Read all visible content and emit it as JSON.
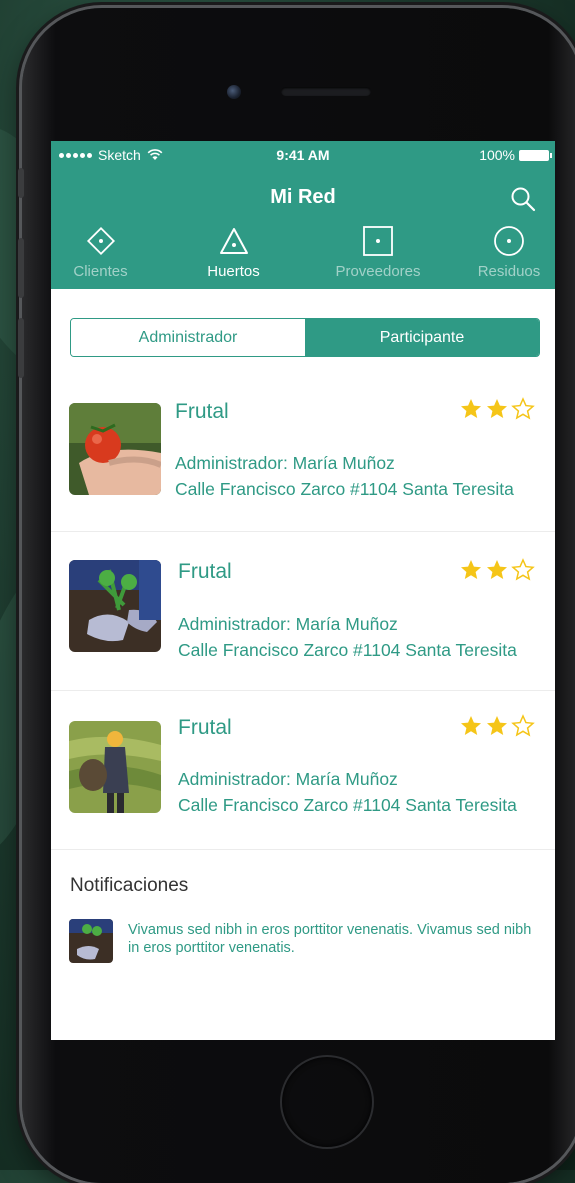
{
  "status_bar": {
    "carrier": "Sketch",
    "time": "9:41 AM",
    "battery": "100%"
  },
  "nav": {
    "title": "Mi Red",
    "icons": [
      "search-icon"
    ]
  },
  "tabs": [
    {
      "label": "Clientes",
      "icon": "diamond-dot-icon",
      "active": false
    },
    {
      "label": "Huertos",
      "icon": "triangle-dot-icon",
      "active": true
    },
    {
      "label": "Proveedores",
      "icon": "square-dot-icon",
      "active": false
    },
    {
      "label": "Residuos",
      "icon": "circle-dot-icon",
      "active": false
    }
  ],
  "segmented": {
    "options": [
      "Administrador",
      "Participante"
    ],
    "selected": "Participante"
  },
  "cards": [
    {
      "name": "Frutal",
      "admin": "Administrador: María Muñoz",
      "address": "Calle Francisco Zarco #1104 Santa Teresita",
      "rating": 2,
      "rating_max": 3,
      "image": "tomato-harvest"
    },
    {
      "name": "Frutal",
      "admin": "Administrador: María Muñoz",
      "address": "Calle Francisco Zarco #1104 Santa Teresita",
      "rating": 2,
      "rating_max": 3,
      "image": "gardening-gloves"
    },
    {
      "name": "Frutal",
      "admin": "Administrador: María Muñoz",
      "address": "Calle Francisco Zarco #1104 Santa Teresita",
      "rating": 2,
      "rating_max": 3,
      "image": "field-worker"
    }
  ],
  "notifications": {
    "title": "Notificaciones",
    "items": [
      {
        "text": "Vivamus sed nibh in eros porttitor venenatis. Vivamus sed nibh in eros porttitor venenatis."
      }
    ]
  },
  "colors": {
    "primary": "#2f9a85",
    "star": "#f5c518",
    "background": "#ffffff"
  }
}
